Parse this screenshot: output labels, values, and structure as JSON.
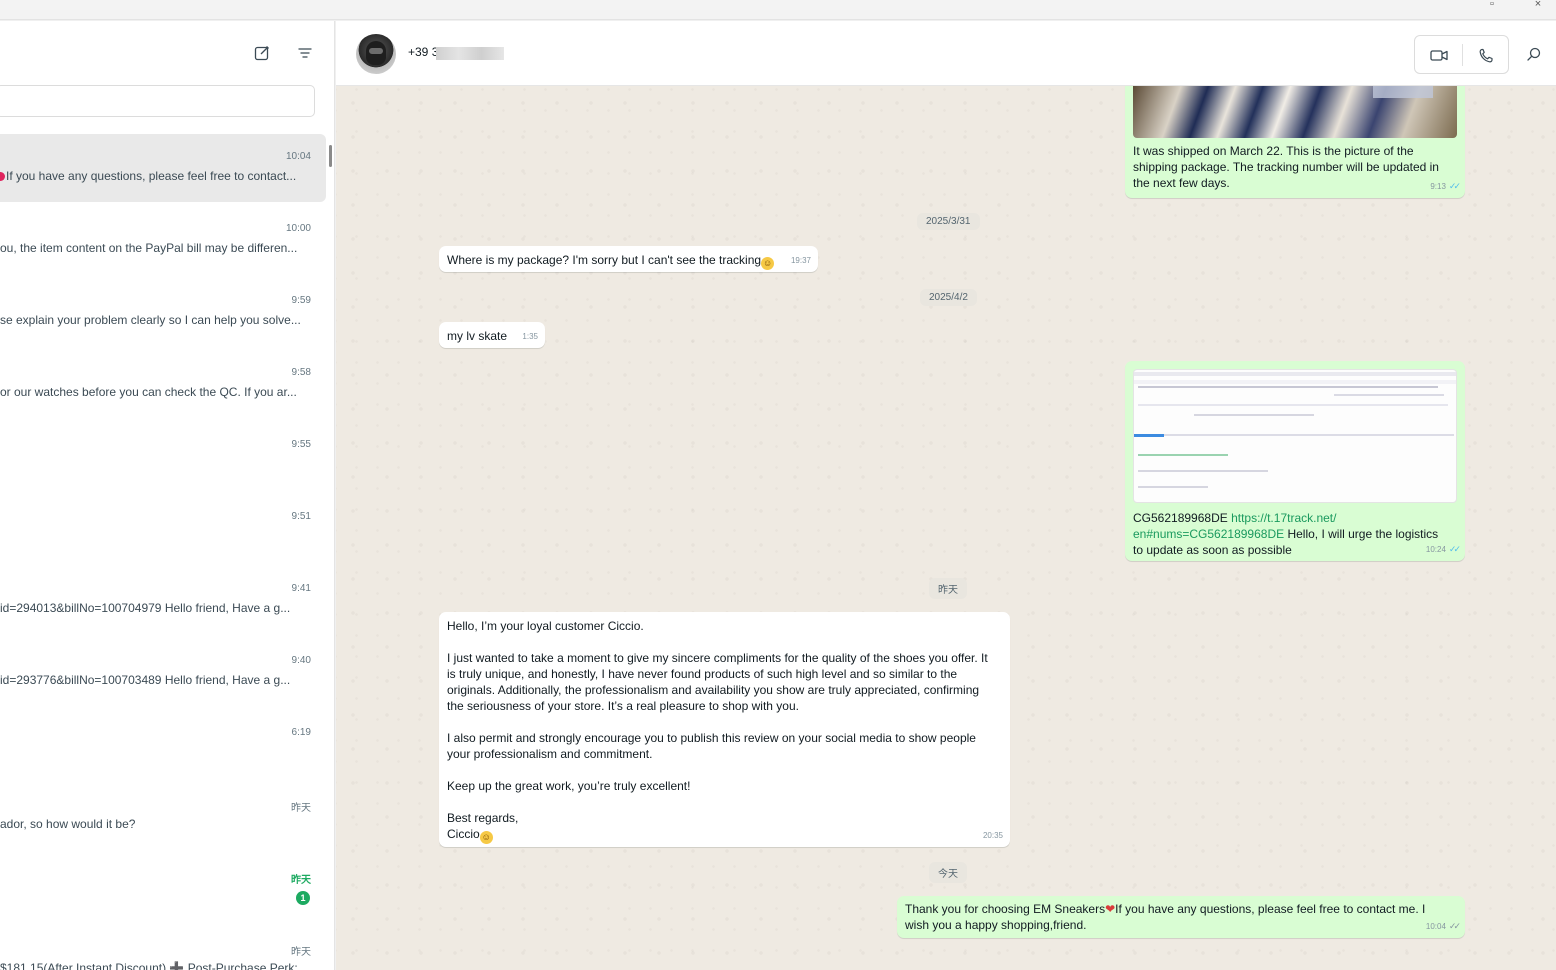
{
  "left_panel": {
    "chats": [
      {
        "time": "10:04",
        "preview": "If you have any questions, please feel free to contact...",
        "has_heart": true,
        "active": true
      },
      {
        "time": "10:00",
        "preview": "ou, the item content on the PayPal bill may be differen..."
      },
      {
        "time": "9:59",
        "preview": "se explain your problem clearly so I can help you solve..."
      },
      {
        "time": "9:58",
        "preview": "or our watches before you can check the QC. If you ar..."
      },
      {
        "time": "9:55",
        "preview": ""
      },
      {
        "time": "9:51",
        "preview": ""
      },
      {
        "time": "9:41",
        "preview": "id=294013&billNo=100704979 Hello friend, Have a g..."
      },
      {
        "time": "9:40",
        "preview": "id=293776&billNo=100703489 Hello friend, Have a g..."
      },
      {
        "time": "6:19",
        "preview": ""
      },
      {
        "time": "昨天",
        "preview": "ador, so how would it be?"
      },
      {
        "time": "昨天",
        "preview": "",
        "unread": "1"
      },
      {
        "time": "昨天",
        "preview": "$181.15(After Instant Discount) ➕ Post-Purchase Perk:"
      }
    ]
  },
  "chat_header": {
    "contact_name": "+39 3"
  },
  "messages": {
    "m1_text": "It was shipped on March 22. This is the picture of the shipping package. The tracking number will be updated in the next few days.",
    "m1_time": "9:13",
    "date1": "2025/3/31",
    "m2_text": "Where is my package? I'm sorry but I can't see the tracking",
    "m2_time": "19:37",
    "date2": "2025/4/2",
    "m3_text": "my lv skate",
    "m3_time": "1:35",
    "m4_code": "CG562189968DE",
    "m4_link": "https://t.17track.net/en#nums=CG562189968DE",
    "m4_link_a": "https://t.17track.net/",
    "m4_link_b": "en#nums=CG562189968DE",
    "m4_rest_a": "Hello, I will urge the logistics",
    "m4_rest_b": "to update as soon as possible",
    "m4_time": "10:24",
    "date3": "昨天",
    "m5_p1": "Hello, I’m your loyal customer Ciccio.",
    "m5_p2": "I just wanted to take a moment to give my sincere compliments for the quality of the shoes you offer. It is truly unique, and honestly, I have never found products of such high level and so similar to the originals. Additionally, the professionalism and availability you show are truly appreciated, confirming the seriousness of your store. It’s a real pleasure to shop with you.",
    "m5_p3": "I also permit and strongly encourage you to publish this review on your social media to show people your professionalism and commitment.",
    "m5_p4": "Keep up the great work, you’re truly excellent!",
    "m5_p5": "Best regards,",
    "m5_p6": "Ciccio",
    "m5_time": "20:35",
    "date4": "今天",
    "m6_a": "Thank you for choosing EM Sneakers",
    "m6_b": "If you have any questions, please feel free to contact me. I wish you a happy shopping,friend.",
    "m6_time": "10:04"
  },
  "icons": {
    "new_chat": "compose-icon",
    "filter": "filter-icon",
    "video": "video-call-icon",
    "voice": "voice-call-icon",
    "search": "search-icon"
  },
  "colors": {
    "outgoing_bubble": "#d9fdd3",
    "incoming_bubble": "#ffffff",
    "chat_background": "#efeae2",
    "unread_green": "#1daa61",
    "read_tick": "#53bdeb"
  }
}
